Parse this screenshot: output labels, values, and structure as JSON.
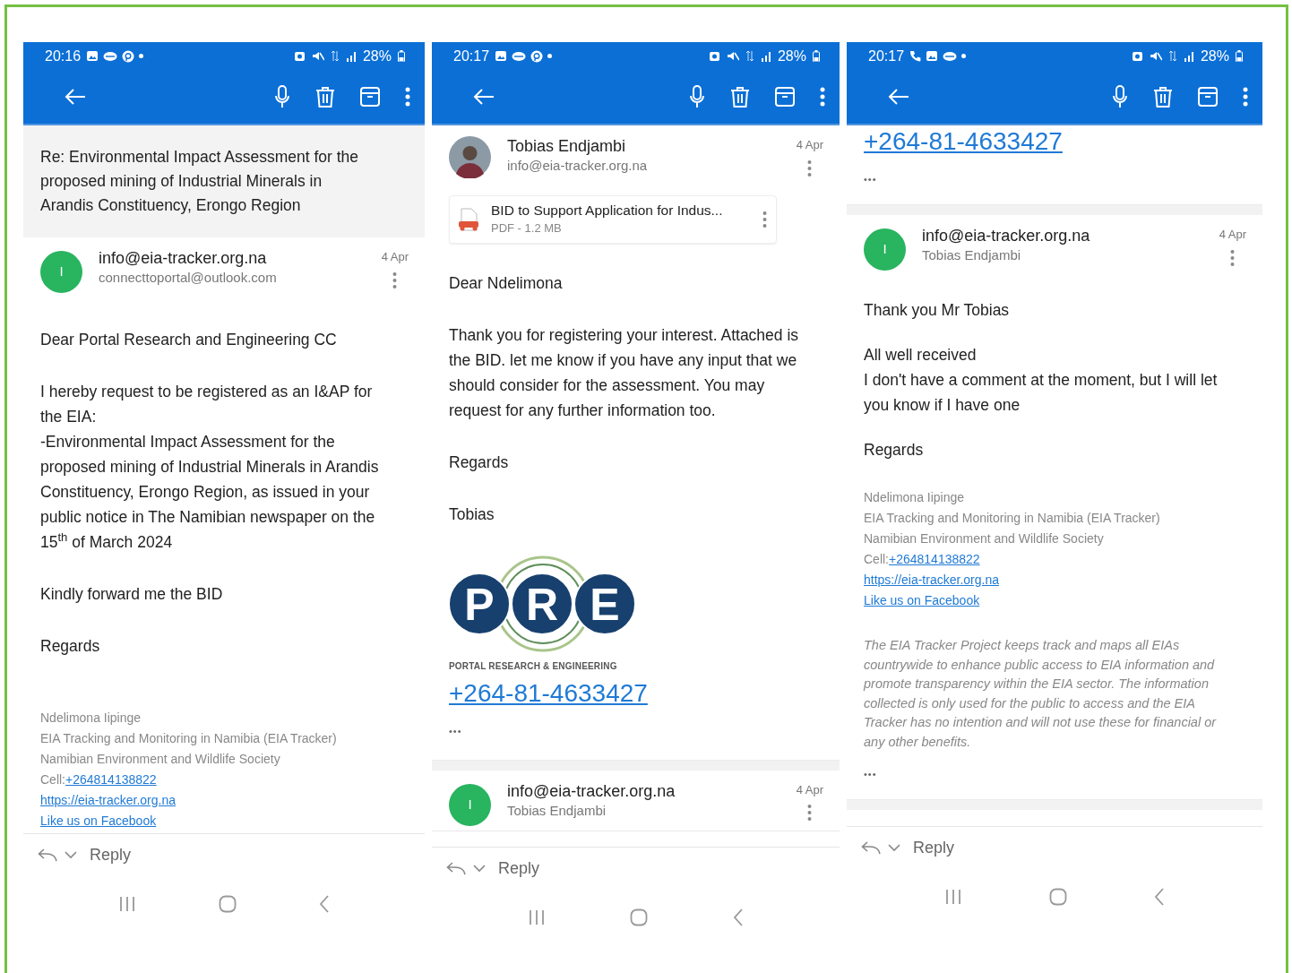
{
  "screens": [
    {
      "status_bar": {
        "time": "20:16",
        "left_icons": [
          {
            "kind": "image"
          },
          {
            "kind": "chat"
          },
          {
            "kind": "pin"
          },
          {
            "kind": "dot"
          }
        ],
        "battery": "28%"
      },
      "blocks": [
        {
          "kind": "subject",
          "text": "Re: Environmental Impact Assessment for the proposed mining of Industrial Minerals in Arandis Constituency, Erongo Region"
        },
        {
          "kind": "sender",
          "avatar": {
            "kind": "letter",
            "letter": "I"
          },
          "name": "info@eia-tracker.org.na",
          "address": "connecttoportal@outlook.com",
          "date": "4 Apr"
        },
        {
          "kind": "text",
          "lines": [
            "Dear Portal Research and Engineering CC"
          ]
        },
        {
          "kind": "text",
          "lines": [
            "I hereby request to be registered as an I&AP for the EIA:",
            "-Environmental Impact Assessment for the proposed mining of Industrial Minerals in Arandis Constituency, Erongo Region, as issued in your public notice in The Namibian newspaper on the 15$^{th}$ of March 2024"
          ]
        },
        {
          "kind": "text",
          "lines": [
            "Kindly forward me the BID"
          ]
        },
        {
          "kind": "text",
          "lines": [
            "Regards"
          ]
        },
        {
          "kind": "signature",
          "lines": [
            {
              "kind": "plain",
              "text": "Ndelimona Iipinge"
            },
            {
              "kind": "plain",
              "text": "EIA Tracking and Monitoring in Namibia (EIA Tracker)"
            },
            {
              "kind": "plain",
              "text": "Namibian Environment and Wildlife Society"
            },
            {
              "kind": "cell",
              "label": "Cell:",
              "link": "+264814138822"
            },
            {
              "kind": "link",
              "text": "https://eia-tracker.org.na"
            },
            {
              "kind": "link",
              "text": "Like us on Facebook"
            }
          ]
        }
      ],
      "reply": "Reply"
    },
    {
      "status_bar": {
        "time": "20:17",
        "left_icons": [
          {
            "kind": "image"
          },
          {
            "kind": "chat"
          },
          {
            "kind": "pin"
          },
          {
            "kind": "dot"
          }
        ],
        "battery": "28%"
      },
      "blocks": [
        {
          "kind": "sender",
          "avatar": {
            "kind": "photo"
          },
          "name": "Tobias Endjambi",
          "address": "info@eia-tracker.org.na",
          "date": "4 Apr"
        },
        {
          "kind": "attachment",
          "name": "BID to Support Application for Indus...",
          "meta": "PDF - 1.2 MB"
        },
        {
          "kind": "text",
          "lines": [
            "Dear  Ndelimona"
          ]
        },
        {
          "kind": "text",
          "lines": [
            "Thank you for registering your interest. Attached is the BID. let me know if you have any input that we should consider for the assessment. You may request for any further information too."
          ]
        },
        {
          "kind": "text",
          "lines": [
            "Regards"
          ]
        },
        {
          "kind": "text",
          "lines": [
            "Tobias"
          ]
        },
        {
          "kind": "logo",
          "letters": [
            "P",
            "R",
            "E"
          ],
          "caption": "PORTAL RESEARCH & ENGINEERING"
        },
        {
          "kind": "phone_link",
          "text": "+264-81-4633427"
        },
        {
          "kind": "more",
          "text": "•••"
        },
        {
          "kind": "separator"
        },
        {
          "kind": "sender",
          "avatar": {
            "kind": "letter",
            "letter": "I"
          },
          "name": "info@eia-tracker.org.na",
          "address": "Tobias Endjambi",
          "date": "4 Apr"
        }
      ],
      "reply": "Reply"
    },
    {
      "status_bar": {
        "time": "20:17",
        "left_icons": [
          {
            "kind": "phone"
          },
          {
            "kind": "image"
          },
          {
            "kind": "chat"
          },
          {
            "kind": "dot"
          }
        ],
        "battery": "28%"
      },
      "blocks": [
        {
          "kind": "phone_link",
          "text": "+264-81-4633427"
        },
        {
          "kind": "more",
          "text": "•••"
        },
        {
          "kind": "separator"
        },
        {
          "kind": "sender",
          "avatar": {
            "kind": "letter",
            "letter": "I"
          },
          "name": "info@eia-tracker.org.na",
          "address": "Tobias Endjambi",
          "date": "4 Apr"
        },
        {
          "kind": "text",
          "lines": [
            "Thank you Mr Tobias"
          ]
        },
        {
          "kind": "text",
          "lines": [
            "All well received",
            "I don't have a comment at the moment, but I will let you know if I have one"
          ]
        },
        {
          "kind": "text",
          "lines": [
            "Regards"
          ]
        },
        {
          "kind": "signature",
          "lines": [
            {
              "kind": "plain",
              "text": "Ndelimona Iipinge"
            },
            {
              "kind": "plain",
              "text": "EIA Tracking and Monitoring in Namibia (EIA Tracker)"
            },
            {
              "kind": "plain",
              "text": "Namibian Environment and Wildlife Society"
            },
            {
              "kind": "cell",
              "label": "Cell:",
              "link": "+264814138822"
            },
            {
              "kind": "link",
              "text": "https://eia-tracker.org.na"
            },
            {
              "kind": "link",
              "text": "Like us on Facebook"
            }
          ]
        },
        {
          "kind": "disclaimer",
          "text": "The EIA Tracker Project keeps track and maps all EIAs countrywide to enhance public access to EIA information and promote transparency within the EIA sector. The information collected is only used for the public to access and the EIA Tracker has no intention and will not use these for financial or any other benefits."
        },
        {
          "kind": "more",
          "text": "•••"
        },
        {
          "kind": "separator"
        }
      ],
      "reply": "Reply"
    }
  ]
}
